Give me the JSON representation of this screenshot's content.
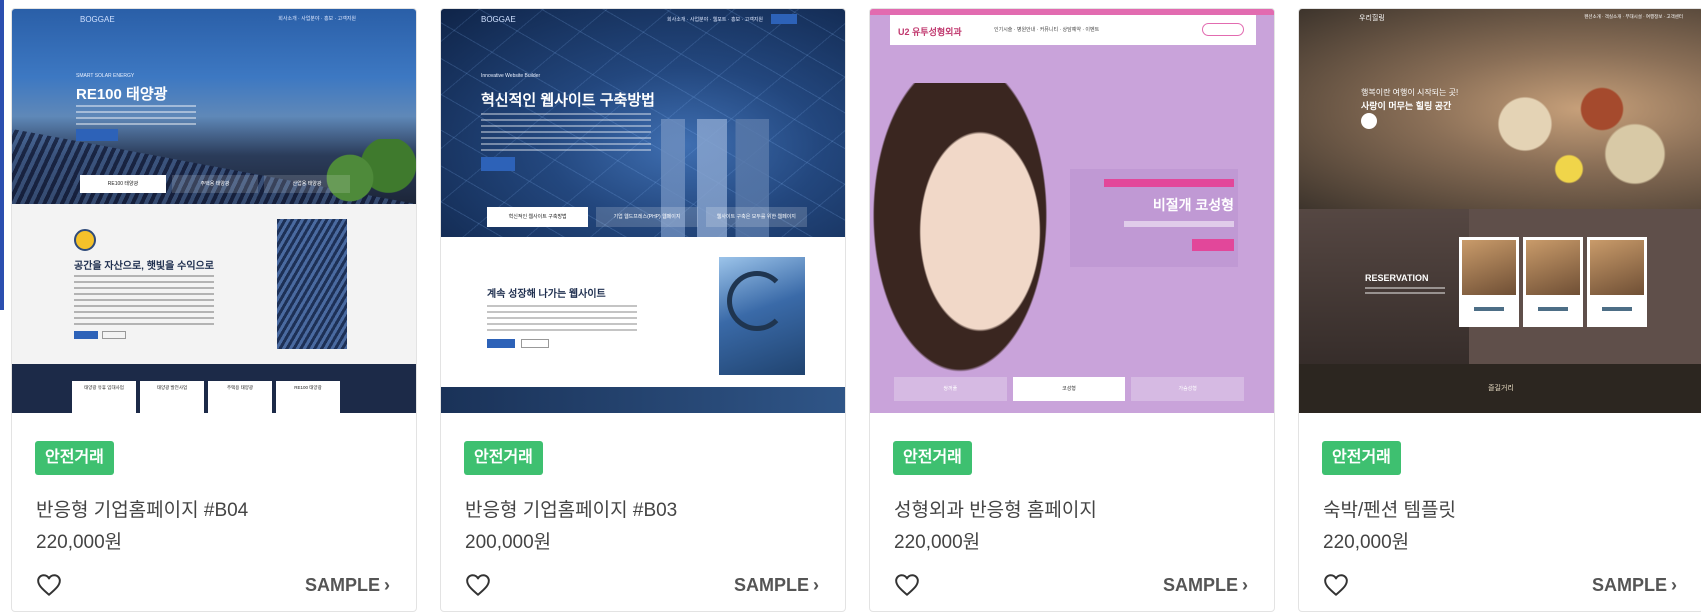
{
  "products": [
    {
      "badge": "안전거래",
      "title": "반응형 기업홈페이지 #B04",
      "price": "220,000원",
      "sample_label": "SAMPLE",
      "thumb": {
        "logo": "BOGGAE",
        "nav": "회사소개 · 사업분야 · 홍보 · 고객지원",
        "sub": "SMART SOLAR ENERGY",
        "headline": "RE100 태양광",
        "tabs": [
          "RE100 태양광",
          "주택용 태양광",
          "산업용 태양광"
        ],
        "section_title": "공간을 자산으로, 햇빛을 수익으로",
        "footer_cards": [
          "태양광 유휴 임대사업",
          "태양광 발전사업",
          "주택용 태양광",
          "RE100 태양광"
        ]
      }
    },
    {
      "badge": "안전거래",
      "title": "반응형 기업홈페이지 #B03",
      "price": "200,000원",
      "sample_label": "SAMPLE",
      "thumb": {
        "logo": "BOGGAE",
        "nav": "회사소개 · 사업분야 · 웹포트 · 홍보 · 고객지원",
        "sub": "Innovative Website Builder",
        "headline": "혁신적인 웹사이트 구축방법",
        "tabs": [
          "혁신적인 웹사이트 구축방법",
          "기업 웹드프레스(PHP) 웹페이지",
          "웹사이트 구축은 모두를 위한 웹페이지"
        ],
        "section_title": "계속 성장해 나가는 웹사이트"
      }
    },
    {
      "badge": "안전거래",
      "title": "성형외과 반응형 홈페이지",
      "price": "220,000원",
      "sample_label": "SAMPLE",
      "thumb": {
        "logo": "U2 유투성형외과",
        "nav": "인기시술 · 병원안내 · 커뮤니티 · 상담예약 · 이벤트",
        "headline": "비절개 코성형",
        "tabs": [
          "쌍꺼풀",
          "코성형",
          "가슴성형"
        ]
      }
    },
    {
      "badge": "안전거래",
      "title": "숙박/펜션 템플릿",
      "price": "220,000원",
      "sample_label": "SAMPLE",
      "thumb": {
        "logo": "우리힐링",
        "nav": "펜션소개 · 객실소개 · 부대시설 · 여행정보 · 고객센터",
        "hero_line1": "행복이란 여행이 시작되는 곳!",
        "hero_line2": "사랑이 머무는 힐링 공간",
        "reservation": "RESERVATION",
        "rooms": [
          "A동 객실",
          "B동 객실",
          "C동 객실"
        ],
        "footer_title": "즐길거리"
      }
    }
  ]
}
